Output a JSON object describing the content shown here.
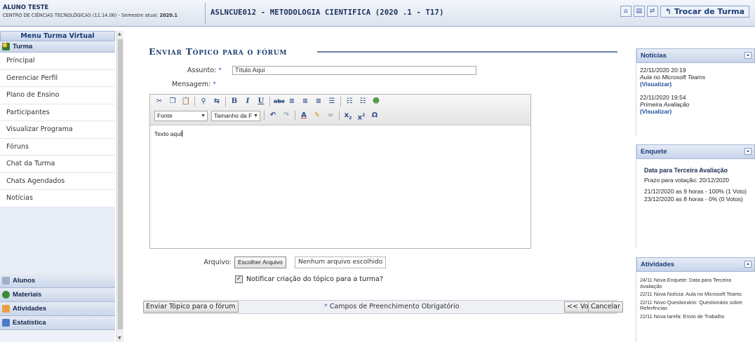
{
  "header": {
    "student_name": "ALUNO TESTE",
    "center_text": "CENTRO DE CIÊNCIAS TECNOLÓGICAS (11.14.06) - Semestre atual:",
    "semester": "2020.1",
    "course_title": "ASLNCUE012 - METODOLOGIA CIENTIFICA (2020 .1 - T17)",
    "tool_icons": [
      "home-icon",
      "print-icon",
      "switch-icon"
    ],
    "swap_class_label": "Trocar de Turma"
  },
  "left_menu": {
    "title": "Menu Turma Virtual",
    "section_turma": "Turma",
    "items": [
      "Principal",
      "Gerenciar Perfil",
      "Plano de Ensino",
      "Participantes",
      "Visualizar Programa",
      "Fóruns",
      "Chat da Turma",
      "Chats Agendados",
      "Notícias"
    ],
    "lower_sections": [
      "Alunos",
      "Materiais",
      "Atividades",
      "Estatística"
    ]
  },
  "form": {
    "title": "Enviar Tópico para o fórum",
    "subject_label": "Assunto:",
    "subject_value": "Título Aqui",
    "message_label": "Mensagem:",
    "required_marker": "*",
    "font_combo": "Fonte",
    "size_combo": "Tamanho da F",
    "editor_text": "Texto aqui",
    "file_label": "Arquivo:",
    "file_button": "Escolher Arquivo",
    "file_status": "Nenhum arquivo escolhido",
    "notify_label": "Notificar criação do tópico para a turma?",
    "notify_checked": true,
    "submit_button": "Enviar Tópico para o fórum",
    "required_note": "Campos de Preenchimento Obrigatório",
    "back_button": "<< Voltar",
    "cancel_button": "Cancelar"
  },
  "right_panels": {
    "news": {
      "title": "Notícias",
      "items": [
        {
          "date": "22/11/2020 20:19",
          "title": "Aula no Microsoft Teams",
          "link": "(Visualizar)"
        },
        {
          "date": "22/11/2020 19:54",
          "title": "Primeira Avaliação",
          "link": "(Visualizar)"
        }
      ]
    },
    "poll": {
      "title": "Enquete",
      "question": "Data para Terceira Avaliação",
      "deadline": "Prazo para votação: 20/12/2020",
      "options": [
        "21/12/2020 as 9 horas - 100% (1 Voto)",
        "23/12/2020 as 8 horas - 0% (0 Votos)"
      ]
    },
    "activities": {
      "title": "Atividades",
      "items": [
        "24/11 Nova Enquete: Data para Terceira Avaliação",
        "22/11 Nova Notícia: Aula no Microsoft Teams",
        "22/11 Novo Questionário: Questionário sobre Referências",
        "22/11 Nova tarefa: Envio de Trabalho"
      ]
    }
  },
  "colors": {
    "title_blue": "#1d3f6e",
    "link_blue": "#1d4fa0",
    "required_blue": "#3c6bd1"
  }
}
